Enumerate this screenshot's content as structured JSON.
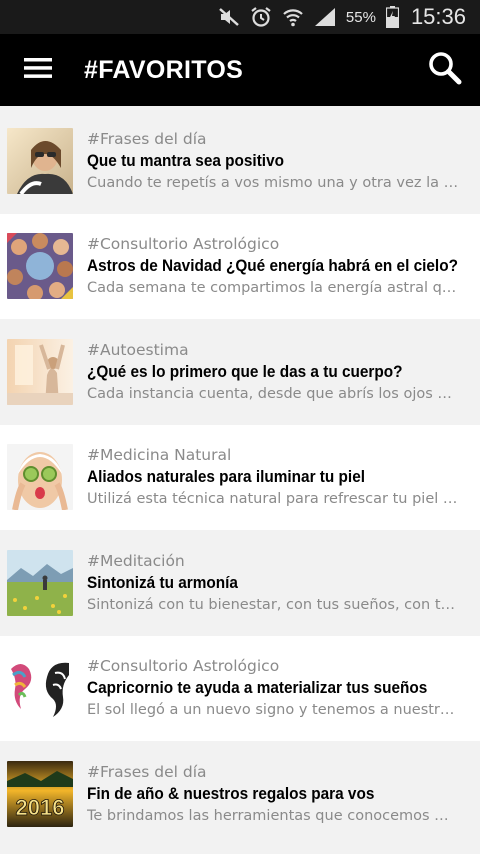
{
  "status_bar": {
    "battery": "55%",
    "time": "15:36",
    "icons": [
      "mute-icon",
      "alarm-icon",
      "wifi-icon",
      "signal-icon",
      "battery-icon"
    ]
  },
  "app_bar": {
    "title": "#FAVORITOS",
    "menu_icon": "hamburger-menu-icon",
    "search_icon": "search-icon"
  },
  "articles": [
    {
      "category": "#Frases del día",
      "title": "Que tu mantra sea positivo",
      "snippet": "Cuando te repetís a vos mismo una y otra vez la …",
      "thumbnail": "woman-smiling-sunglasses-thumbnail"
    },
    {
      "category": "#Consultorio Astrológico",
      "title": "Astros de Navidad ¿Qué energía habrá en el cielo?",
      "snippet": "Cada semana te compartimos la energía astral q…",
      "thumbnail": "group-of-friends-circle-thumbnail"
    },
    {
      "category": "#Autoestima",
      "title": "¿Qué es lo primero que le das a tu cuerpo?",
      "snippet": "Cada instancia cuenta, desde que abrís los ojos …",
      "thumbnail": "woman-stretching-window-thumbnail"
    },
    {
      "category": "#Medicina Natural",
      "title": "Aliados naturales para iluminar tu piel",
      "snippet": "Utilizá esta técnica natural para refrescar tu piel …",
      "thumbnail": "woman-cucumber-eyes-thumbnail"
    },
    {
      "category": "#Meditación",
      "title": "Sintonizá tu armonía",
      "snippet": "Sintonizá con tu bienestar, con tus sueños, con t…",
      "thumbnail": "meadow-flowers-mountains-thumbnail"
    },
    {
      "category": "#Consultorio Astrológico",
      "title": "Capricornio te ayuda a materializar tus sueños",
      "snippet": "El sol llegó a un nuevo signo y tenemos a nuestr…",
      "thumbnail": "capricorn-goat-illustration-thumbnail"
    },
    {
      "category": "#Frases del día",
      "title": "Fin de año & nuestros regalos para vos",
      "snippet": "Te brindamos las herramientas que conocemos …",
      "thumbnail": "2016-sunset-thumbnail",
      "thumb_text": "2016"
    }
  ]
}
